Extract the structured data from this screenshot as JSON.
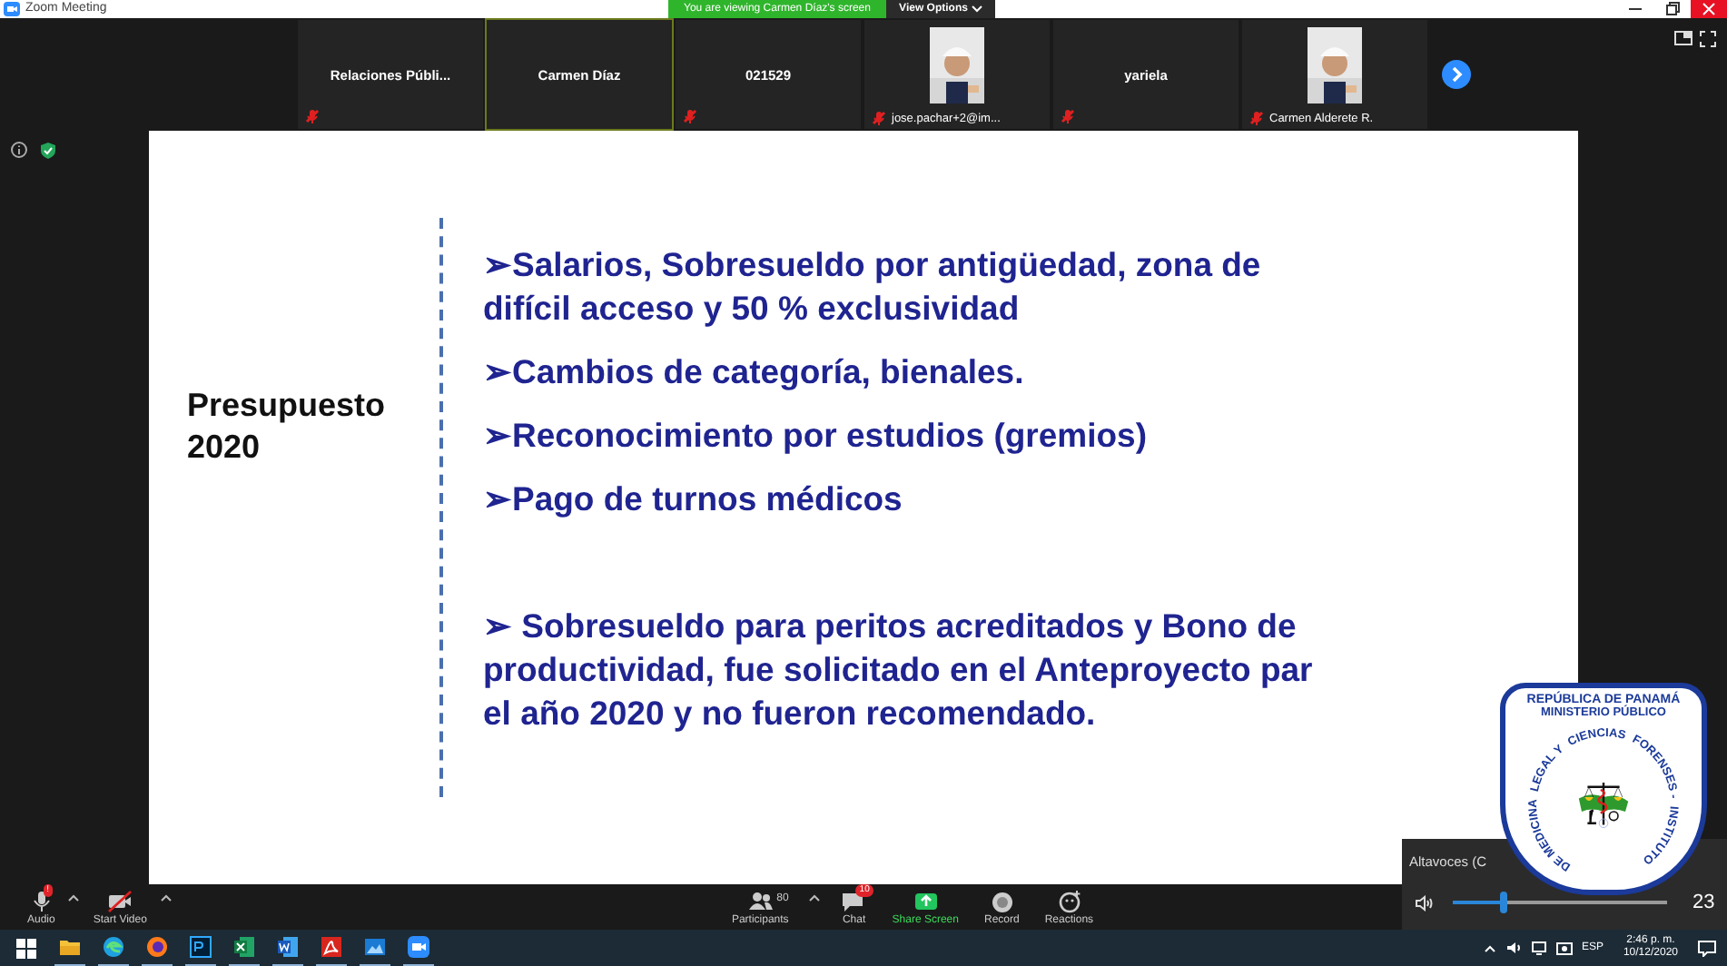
{
  "window": {
    "title": "Zoom Meeting"
  },
  "banner": {
    "text": "You are viewing Carmen Díaz's screen",
    "options": "View Options"
  },
  "participants": [
    {
      "kind": "name",
      "name": "Relaciones  Públi...",
      "muted": true,
      "active": false
    },
    {
      "kind": "name",
      "name": "Carmen Díaz",
      "muted": false,
      "active": true
    },
    {
      "kind": "name",
      "name": "021529",
      "muted": true,
      "active": false
    },
    {
      "kind": "picture",
      "name": "jose.pachar+2@im...",
      "muted": true,
      "active": false
    },
    {
      "kind": "name",
      "name": "yariela",
      "muted": true,
      "active": false
    },
    {
      "kind": "picture",
      "name": "Carmen Alderete R.",
      "muted": true,
      "active": false
    }
  ],
  "slide": {
    "heading": "Presupuesto 2020",
    "bullets": [
      "➢Salarios, Sobresueldo por antigüedad, zona de difícil acceso y 50 % exclusividad",
      "➢Cambios de categoría, bienales.",
      "➢Reconocimiento por estudios (gremios)",
      "➢Pago de turnos médicos"
    ],
    "note": "➢ Sobresueldo para peritos acreditados y Bono de productividad, fue solicitado en el Anteproyecto par el año 2020 y no fueron recomendado."
  },
  "toolbar": {
    "left": [
      {
        "kind": "audio",
        "label": "Audio",
        "badge": "!"
      },
      {
        "kind": "video",
        "label": "Start Video"
      }
    ],
    "center": [
      {
        "kind": "participants",
        "label": "Participants",
        "count": "80"
      },
      {
        "kind": "chat",
        "label": "Chat",
        "badge": "10"
      },
      {
        "kind": "share",
        "label": "Share Screen"
      },
      {
        "kind": "record",
        "label": "Record"
      },
      {
        "kind": "reactions",
        "label": "Reactions"
      }
    ]
  },
  "volume": {
    "device": "Altavoces (C",
    "level": 0.24,
    "value": "23"
  },
  "logo": {
    "line_1": "REPÚBLICA DE PANAMÁ",
    "line_2": "MINISTERIO PÚBLICO",
    "ring": [
      "LEGAL Y",
      "CIENCIAS",
      "DE MEDICINA",
      "FORENSES -",
      "INSTITUTO"
    ]
  },
  "taskbar": {
    "apps": [
      {
        "kind": "start"
      },
      {
        "kind": "explorer"
      },
      {
        "kind": "edge"
      },
      {
        "kind": "firefox"
      },
      {
        "kind": "photoshop"
      },
      {
        "kind": "excel"
      },
      {
        "kind": "word"
      },
      {
        "kind": "acrobat"
      },
      {
        "kind": "photos"
      },
      {
        "kind": "zoom"
      }
    ],
    "language": "ESP",
    "time": "2:46 p. m.",
    "date": "10/12/2020"
  }
}
